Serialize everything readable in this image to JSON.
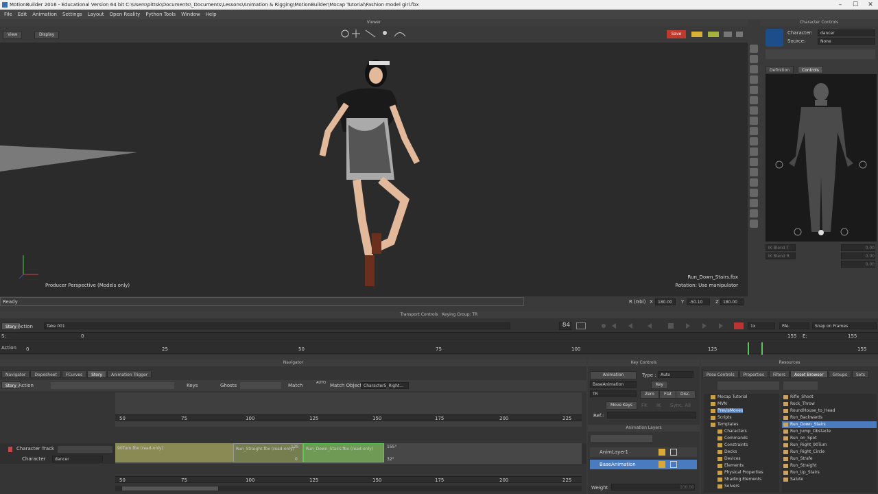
{
  "window": {
    "title": "MotionBuilder 2016 - Educational Version    64 bit   C:\\Users\\pittsk\\Documents\\_Documents\\Lessons\\Animation & Rigging\\MotionBuilder\\Mocap Tutorial\\Fashion model girl.fbx"
  },
  "menu": [
    "File",
    "Edit",
    "Animation",
    "Settings",
    "Layout",
    "Open Reality",
    "Python Tools",
    "Window",
    "Help"
  ],
  "viewer": {
    "header": "Viewer",
    "view_label": "View",
    "display_label": "Display",
    "save_label": "Save",
    "perspective_label": "Producer Perspective (Models only)",
    "clip_name": "Run_Down_Stairs.fbx",
    "rotation_hint": "Rotation: Use manipulator"
  },
  "character_controls": {
    "header": "Character Controls",
    "character_label": "Character:",
    "character_value": "dancer",
    "source_label": "Source:",
    "source_value": "None",
    "tabs": [
      "Definition",
      "Controls"
    ],
    "ik_blend_t": "IK Blend T",
    "ik_blend_r": "IK Blend R",
    "value_zero": "0.00"
  },
  "status": {
    "text": "Ready",
    "r_label": "R (Gbl)",
    "x_label": "X",
    "x_value": "180.00",
    "y_label": "Y",
    "y_value": "-50.10",
    "z_label": "Z",
    "z_value": "180.00"
  },
  "transport": {
    "header": "Transport Controls  ·  Keying Group: TR",
    "story_tab": "Story",
    "action_label": "Action",
    "take": "Take 001",
    "frame": "84",
    "speed": "1x",
    "timecode": "PAL",
    "snap": "Snap on Frames",
    "s_label": "S:",
    "s_value": "0",
    "e_label": "E:",
    "e_value_left": "155",
    "e_value_right": "155",
    "action_row_label": "Action",
    "ruler_ticks": [
      "0",
      "25",
      "50",
      "75",
      "100",
      "125",
      "155"
    ]
  },
  "navigator": {
    "header": "Navigator",
    "tabs": [
      "Navigator",
      "Dopesheet",
      "FCurves",
      "Story",
      "Animation Trigger"
    ],
    "toolbar": {
      "story": "Story",
      "action": "Action",
      "keys": "Keys",
      "ghosts": "Ghosts",
      "match": "Match",
      "auto": "AUTO",
      "match_object": "Match Object",
      "match_object_value": "Character5_Right..."
    },
    "ruler_ticks": [
      "50",
      "75",
      "100",
      "125",
      "150",
      "175",
      "200",
      "225"
    ],
    "track": {
      "name": "Character Track",
      "sub_label": "Character",
      "sub_value": "dancer"
    },
    "clips": [
      {
        "label": "90Turn.fbx (read-only)"
      },
      {
        "label": "Run_Straight.fbx (read-only)"
      },
      {
        "label": "Run_Down_Stairs.fbx (read-only)"
      }
    ],
    "clip_markers": [
      "155°",
      "32°",
      "125",
      "0"
    ]
  },
  "key_controls": {
    "header": "Key Controls",
    "animation_btn": "Animation",
    "type_label": "Type :",
    "type_value": "Auto",
    "base_animation": "BaseAnimation",
    "key_btn": "Key",
    "tr_value": "TR",
    "zero_btn": "Zero",
    "flat_btn": "Flat",
    "disc_btn": "Disc.",
    "move_keys": "Move Keys",
    "fk": "FK",
    "ik": "IK",
    "sync_all": "Sync. All",
    "ref_label": "Ref.:",
    "layers_header": "Animation Layers",
    "layers": [
      "AnimLayer1",
      "BaseAnimation"
    ],
    "weight_label": "Weight",
    "weight_value": "100.00"
  },
  "resources": {
    "header": "Resources",
    "tabs": [
      "Pose Controls",
      "Properties",
      "Filters",
      "Asset Browser",
      "Groups",
      "Sets"
    ],
    "tree": [
      "Mocap Tutorial",
      "MVN",
      "PrevisMoves",
      "Scripts",
      "Templates",
      "Characters",
      "Commands",
      "Constraints",
      "Decks",
      "Devices",
      "Elements",
      "Physical Properties",
      "Shading Elements",
      "Solvers"
    ],
    "assets": [
      "Rifle_Shoot",
      "Rock_Throw",
      "RoundHouse_to_Head",
      "Run_Backwards",
      "Run_Down_Stairs",
      "Run_Jump_Obstacle",
      "Run_on_Spot",
      "Run_Right_90Turn",
      "Run_Right_Circle",
      "Run_Strafe",
      "Run_Straight",
      "Run_Up_Stairs",
      "Salute"
    ]
  },
  "colors": {
    "accent": "#4b7bbf",
    "save": "#c0392b",
    "clip_yellow": "#8a8a55",
    "clip_green": "#6f9a55",
    "timeline_marker": "#55cc55"
  }
}
